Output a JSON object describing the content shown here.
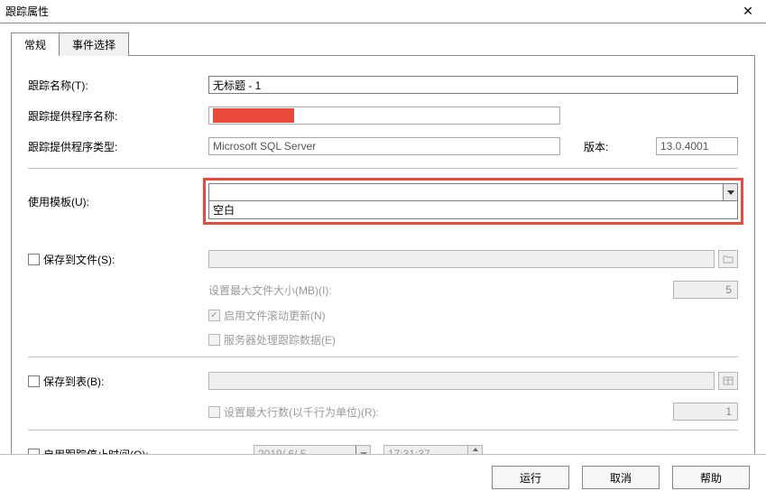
{
  "window": {
    "title": "跟踪属性",
    "close": "✕"
  },
  "tabs": {
    "general": "常规",
    "events": "事件选择"
  },
  "labels": {
    "traceName": "跟踪名称(T):",
    "providerName": "跟踪提供程序名称:",
    "providerType": "跟踪提供程序类型:",
    "version": "版本:",
    "useTemplate": "使用模板(U):",
    "saveToFile": "保存到文件(S):",
    "setMaxFileSize": "设置最大文件大小(MB)(I):",
    "enableRollover": "启用文件滚动更新(N)",
    "serverProcesses": "服务器处理跟踪数据(E)",
    "saveToTable": "保存到表(B):",
    "setMaxRows": "设置最大行数(以千行为单位)(R):",
    "enableStopTime": "启用跟踪停止时间(O):"
  },
  "values": {
    "traceName": "无标题 - 1",
    "providerType": "Microsoft SQL Server",
    "version": "13.0.4001",
    "templateOption": "空白",
    "maxFileSize": "5",
    "maxRows": "1",
    "stopDate": "2019/ 6/ 5",
    "stopTime": "17:31:37"
  },
  "buttons": {
    "run": "运行",
    "cancel": "取消",
    "help": "帮助"
  }
}
